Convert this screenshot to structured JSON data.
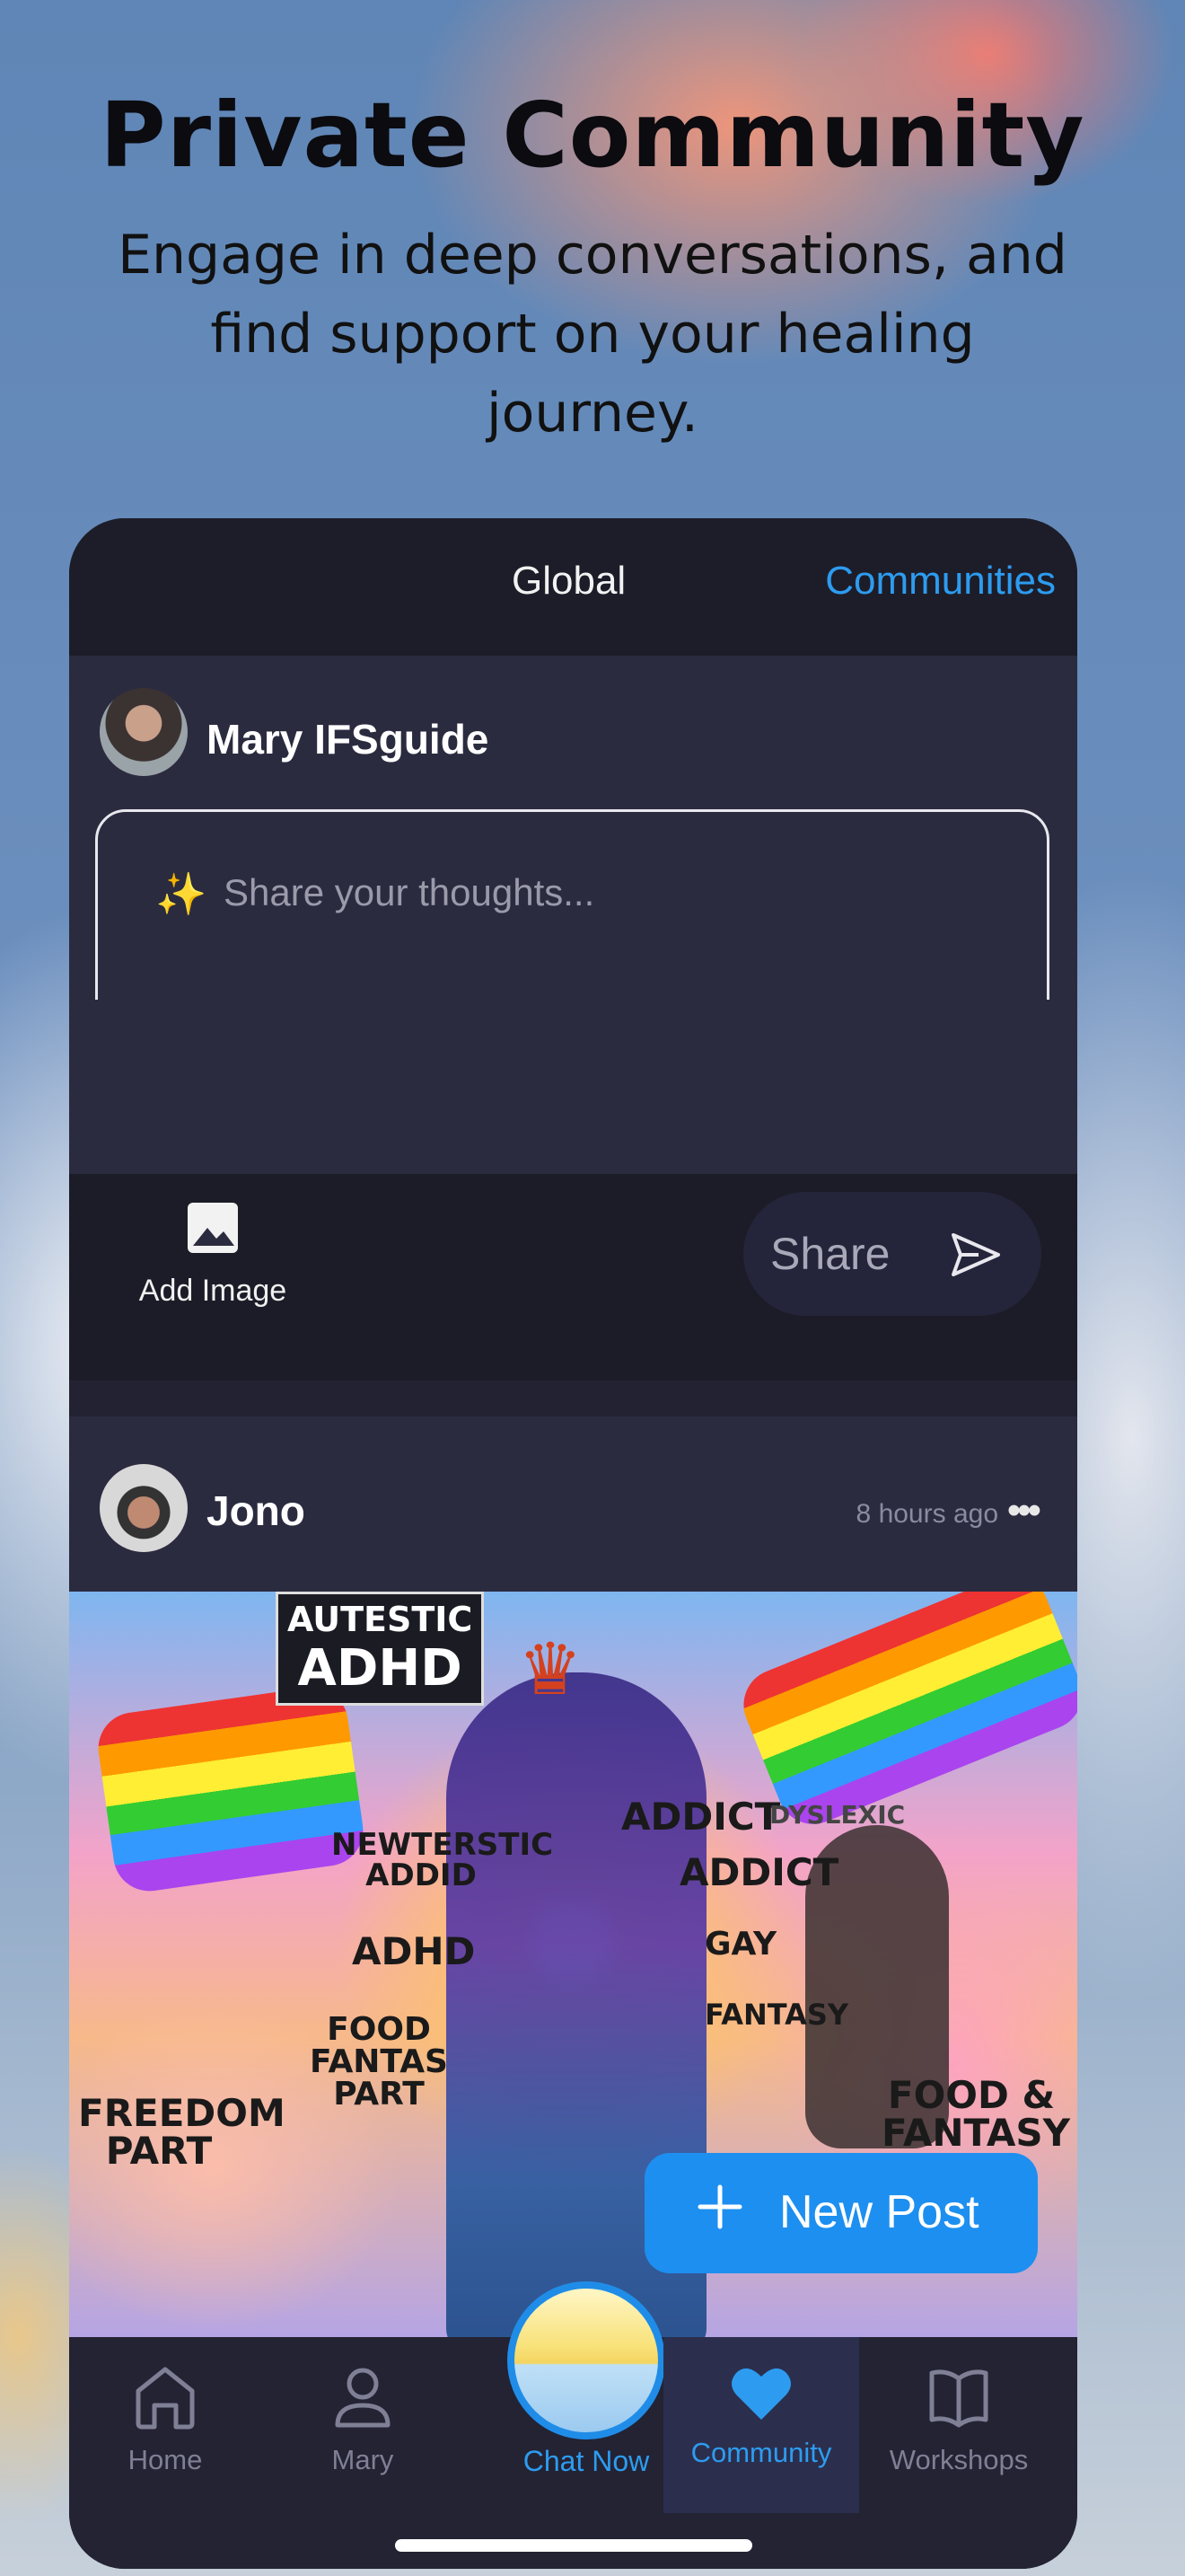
{
  "promo": {
    "title": "Private Community",
    "subtitle": "Engage in deep conversations, and find support on your healing journey."
  },
  "topbar": {
    "tab_global": "Global",
    "tab_communities": "Communities"
  },
  "composer": {
    "user_name": "Mary IFSguide",
    "sparkle_emoji": "✨",
    "placeholder": "Share your thoughts...",
    "add_image_label": "Add Image",
    "share_label": "Share"
  },
  "post": {
    "author": "Jono",
    "time": "8 hours ago",
    "more": "•••",
    "image_text": {
      "sign_line1": "AUTESTIC",
      "sign_line2": "ADHD",
      "words": [
        "NEWTERSTIC ADDID",
        "ADHD",
        "FOOD FANTAS PART",
        "FREEDOM PART",
        "ADDICT",
        "ADDICT",
        "DYSLEXIC",
        "GAY",
        "FANTASY",
        "FOOD & FANTASY"
      ]
    }
  },
  "fab": {
    "label": "New Post"
  },
  "nav": {
    "items": [
      {
        "label": "Home",
        "icon": "home-icon"
      },
      {
        "label": "Mary",
        "icon": "person-icon"
      },
      {
        "label": "Chat Now",
        "icon": "sun-icon"
      },
      {
        "label": "Community",
        "icon": "heart-icon"
      },
      {
        "label": "Workshops",
        "icon": "book-icon"
      }
    ]
  },
  "colors": {
    "accent": "#2d9cf0",
    "panel": "#2b2b40",
    "dark": "#1c1c28"
  }
}
